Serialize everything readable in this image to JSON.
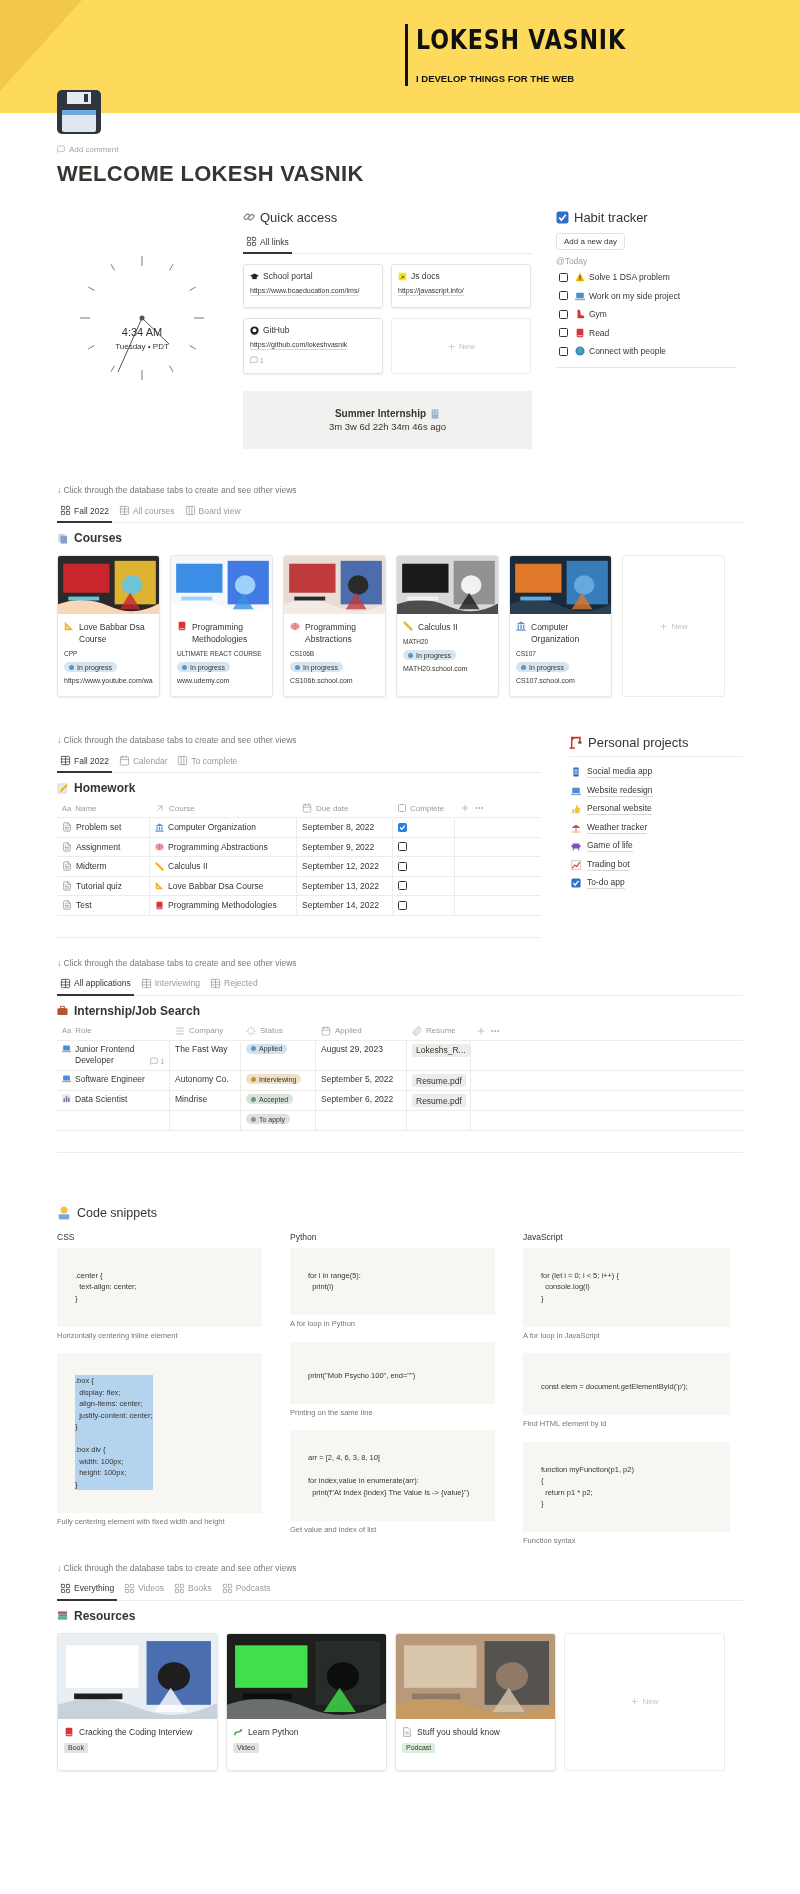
{
  "cover": {
    "name": "LOKESH VASNIK",
    "tagline": "I DEVELOP THINGS FOR THE WEB"
  },
  "page": {
    "add_comment": "Add comment",
    "title": "WELCOME LOKESH VASNIK"
  },
  "clock": {
    "time": "4:34 AM",
    "date": "Tuesday • PDT"
  },
  "quick_access": {
    "title": "Quick access",
    "tabs": [
      {
        "label": "All links",
        "selected": true
      }
    ],
    "links": [
      {
        "title": "School portal",
        "url": "https://www.bcaeducation.com/lms/"
      },
      {
        "title": "Js docs",
        "url": "https://javascript.info/"
      },
      {
        "title": "GitHub",
        "url": "https://github.com/lokeshvasnik",
        "comments": "1"
      }
    ],
    "new_label": "New"
  },
  "countdown": {
    "title": "Summer Internship",
    "elapsed": "3m 3w 6d 22h 34m 46s ago"
  },
  "habit_tracker": {
    "title": "Habit tracker",
    "add_button": "Add a new day",
    "date": "@Today",
    "habits": [
      {
        "label": "Solve 1 DSA problem",
        "checked": false
      },
      {
        "label": "Work on my side project",
        "checked": false
      },
      {
        "label": "Gym",
        "checked": false
      },
      {
        "label": "Read",
        "checked": false
      },
      {
        "label": "Connect with people",
        "checked": false
      }
    ]
  },
  "courses": {
    "hint": "↓ Click through the database tabs to create and see other views",
    "tabs": [
      {
        "label": "Fall 2022",
        "selected": true
      },
      {
        "label": "All courses",
        "selected": false
      },
      {
        "label": "Board view",
        "selected": false
      }
    ],
    "title": "Courses",
    "cards": [
      {
        "title": "Love Babbar Dsa Course",
        "code": "CPP",
        "status": "In progress",
        "url": "https://www.youtube.com/wa"
      },
      {
        "title": "Programming Methodologies",
        "code": "ULTIMATE REACT COURSE",
        "status": "In progress",
        "url": "www.udemy.com"
      },
      {
        "title": "Programming Abstractions",
        "code": "CS106B",
        "status": "In progress",
        "url": "CS106b.school.com"
      },
      {
        "title": "Calculus II",
        "code": "MATH20",
        "status": "In progress",
        "url": "MATH20.school.com"
      },
      {
        "title": "Computer Organization",
        "code": "CS107",
        "status": "In progress",
        "url": "CS107.school.com"
      }
    ],
    "new_label": "New"
  },
  "homework": {
    "hint": "↓ Click through the database tabs to create and see other views",
    "tabs": [
      {
        "label": "Fall 2022",
        "selected": true
      },
      {
        "label": "Calendar",
        "selected": false
      },
      {
        "label": "To complete",
        "selected": false
      }
    ],
    "title": "Homework",
    "columns": [
      {
        "mark": "Aa",
        "label": "Name"
      },
      {
        "label": "Course"
      },
      {
        "label": "Due date"
      },
      {
        "label": "Complete"
      }
    ],
    "rows": [
      {
        "name": "Problem set",
        "course": "Computer Organization",
        "due": "September 8, 2022",
        "complete": true
      },
      {
        "name": "Assignment",
        "course": "Programming Abstractions",
        "due": "September 9, 2022",
        "complete": false
      },
      {
        "name": "Midterm",
        "course": "Calculus II",
        "due": "September 12, 2022",
        "complete": false
      },
      {
        "name": "Tutorial quiz",
        "course": "Love Babbar Dsa Course",
        "due": "September 13, 2022",
        "complete": false
      },
      {
        "name": "Test",
        "course": "Programming Methodologies",
        "due": "September 14, 2022",
        "complete": false
      }
    ]
  },
  "personal_projects": {
    "title": "Personal projects",
    "items": [
      {
        "label": "Social media app"
      },
      {
        "label": "Website redesign"
      },
      {
        "label": "Personal website"
      },
      {
        "label": "Weather tracker"
      },
      {
        "label": "Game of life"
      },
      {
        "label": "Trading bot"
      },
      {
        "label": "To-do app"
      }
    ]
  },
  "internships": {
    "hint": "↓ Click through the database tabs to create and see other views",
    "tabs": [
      {
        "label": "All applications",
        "selected": true
      },
      {
        "label": "Interviewing",
        "selected": false
      },
      {
        "label": "Rejected",
        "selected": false
      }
    ],
    "title": "Internship/Job Search",
    "columns": [
      {
        "mark": "Aa",
        "label": "Role"
      },
      {
        "label": "Company"
      },
      {
        "label": "Status"
      },
      {
        "label": "Applied"
      },
      {
        "label": "Resume"
      }
    ],
    "rows": [
      {
        "role": "Junior Frontend Developer",
        "comments": "1",
        "company": "The Fast Way",
        "status": {
          "label": "Applied",
          "color": "#5b97bd"
        },
        "applied": "August 29, 2023",
        "resume": "Lokeshs_R..."
      },
      {
        "role": "Software Engineer",
        "company": "Autonomy Co.",
        "status": {
          "label": "Interviewing",
          "color": "#cb912f"
        },
        "applied": "September 5, 2022",
        "resume": "Resume.pdf"
      },
      {
        "role": "Data Scientist",
        "company": "Mindrise",
        "status": {
          "label": "Accepted",
          "color": "#6c9b7d"
        },
        "applied": "September 6, 2022",
        "resume": "Resume.pdf"
      },
      {
        "status": {
          "label": "To apply",
          "color": "#91918e"
        }
      }
    ]
  },
  "code_snippets": {
    "title": "Code snippets",
    "columns": [
      {
        "label": "CSS",
        "snippets": [
          {
            "code": ".center {\n  text-align: center;\n}",
            "caption": "Horizontally centering inline element",
            "highlighted": false
          },
          {
            "code": ".box {\n  display: flex;\n  align-items: center;\n  justify-content: center;\n}\n\n.box div {\n  width: 100px;\n  height: 100px;\n}",
            "caption": "Fully centering element with fixed width and height",
            "highlighted": true
          }
        ]
      },
      {
        "label": "Python",
        "snippets": [
          {
            "code": "for i in range(5):\n  print(i)",
            "caption": "A for loop in Python",
            "highlighted": false
          },
          {
            "code": "print(\"Mob Psycho 100\", end=\"\")",
            "caption": "Printing on the same line",
            "highlighted": false
          },
          {
            "code": "arr = [2, 4, 6, 3, 8, 10]\n\nfor index,value in enumerate(arr):\n  print(f\"At Index {index} The Value Is -> {value}\")",
            "caption": "Get value and index of list",
            "highlighted": false
          }
        ]
      },
      {
        "label": "JavaScript",
        "snippets": [
          {
            "code": "for (let i = 0; i < 5; i++) {\n  console.log(i)\n}",
            "caption": "A for loop in JavaScript",
            "highlighted": false
          },
          {
            "code": "const elem = document.getElementById('p');",
            "caption": "Find HTML element by id",
            "highlighted": false
          },
          {
            "code": "function myFunction(p1, p2)\n{\n  return p1 * p2;\n}",
            "caption": "Function syntax",
            "highlighted": false
          }
        ]
      }
    ]
  },
  "resources": {
    "hint": "↓ Click through the database tabs to create and see other views",
    "tabs": [
      {
        "label": "Everything",
        "selected": true
      },
      {
        "label": "Videos",
        "selected": false
      },
      {
        "label": "Books",
        "selected": false
      },
      {
        "label": "Podcasts",
        "selected": false
      }
    ],
    "title": "Resources",
    "cards": [
      {
        "title": "Cracking the Coding Interview",
        "tag": "Book",
        "color": "#e3e2e0"
      },
      {
        "title": "Learn Python",
        "tag": "Video",
        "color": "#e3e2e0"
      },
      {
        "title": "Stuff you should know",
        "tag": "Podcast",
        "color": "#dbeddb"
      }
    ],
    "new_label": "New"
  }
}
